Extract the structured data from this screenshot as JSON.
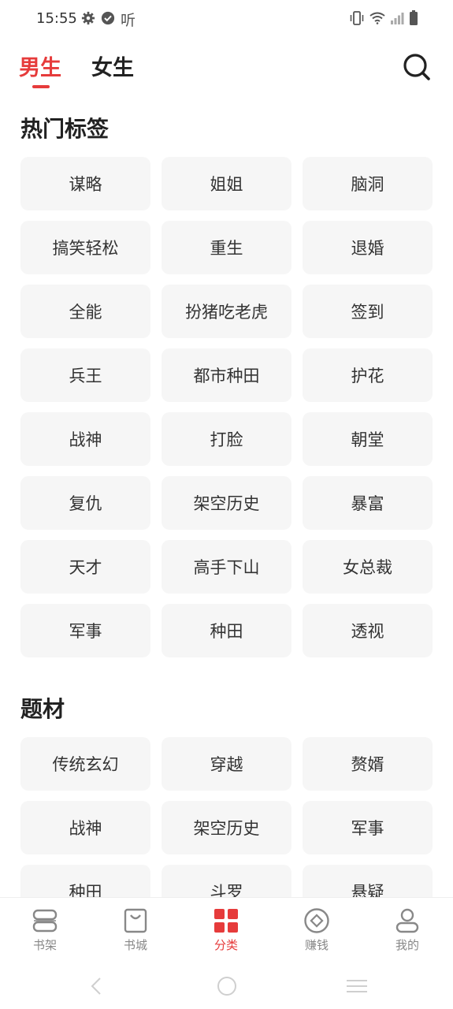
{
  "status_bar": {
    "time": "15:55",
    "listen_label": "听",
    "icons": [
      "gear-icon",
      "check-circle-icon",
      "vibrate-icon",
      "wifi-icon",
      "signal-icon",
      "battery-icon"
    ]
  },
  "top_tabs": [
    {
      "label": "男生",
      "active": true
    },
    {
      "label": "女生",
      "active": false
    }
  ],
  "colors": {
    "accent": "#e63b3b",
    "chip_bg": "#f6f6f6",
    "text": "#222222",
    "nav_inactive": "#888888"
  },
  "hot_tags": {
    "title": "热门标签",
    "items": [
      "谋略",
      "姐姐",
      "脑洞",
      "搞笑轻松",
      "重生",
      "退婚",
      "全能",
      "扮猪吃老虎",
      "签到",
      "兵王",
      "都市种田",
      "护花",
      "战神",
      "打脸",
      "朝堂",
      "复仇",
      "架空历史",
      "暴富",
      "天才",
      "高手下山",
      "女总裁",
      "军事",
      "种田",
      "透视"
    ]
  },
  "themes": {
    "title": "题材",
    "items": [
      "传统玄幻",
      "穿越",
      "赘婿",
      "战神",
      "架空历史",
      "军事",
      "种田",
      "斗罗",
      "悬疑"
    ]
  },
  "bottom_nav": [
    {
      "label": "书架",
      "icon": "bookshelf-icon",
      "active": false
    },
    {
      "label": "书城",
      "icon": "shopping-bag-icon",
      "active": false
    },
    {
      "label": "分类",
      "icon": "category-grid-icon",
      "active": true
    },
    {
      "label": "赚钱",
      "icon": "coin-icon",
      "active": false
    },
    {
      "label": "我的",
      "icon": "profile-icon",
      "active": false
    }
  ]
}
